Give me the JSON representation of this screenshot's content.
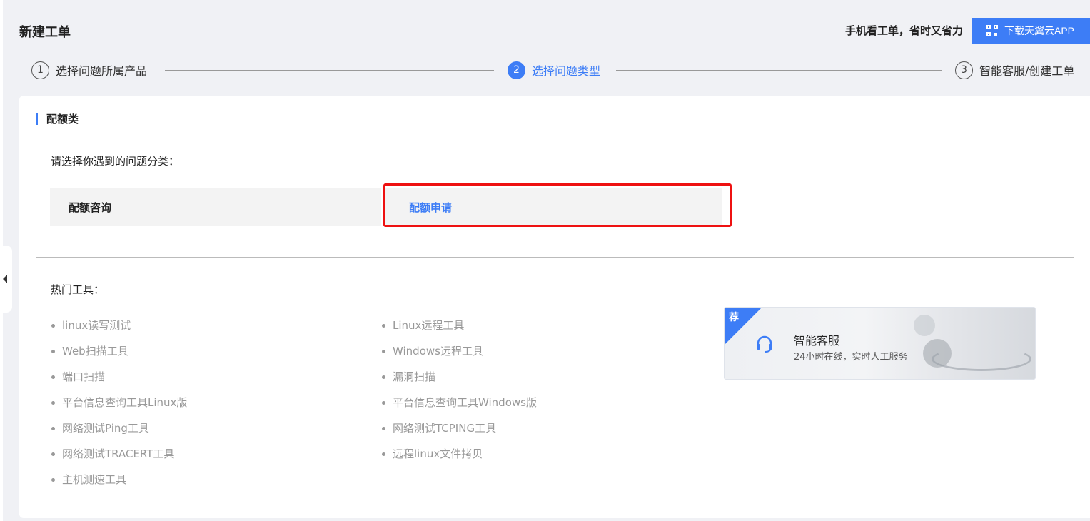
{
  "header": {
    "title": "新建工单",
    "promo_text": "手机看工单，省时又省力",
    "download_label": "下载天翼云APP",
    "download_icon": "qr-code-icon"
  },
  "steps": [
    {
      "num": "1",
      "label": "选择问题所属产品",
      "active": false
    },
    {
      "num": "2",
      "label": "选择问题类型",
      "active": true
    },
    {
      "num": "3",
      "label": "智能客服/创建工单",
      "active": false
    }
  ],
  "section": {
    "title": "配额类",
    "prompt": "请选择你遇到的问题分类：",
    "options": [
      "配额咨询",
      "配额申请"
    ],
    "selected": "配额申请"
  },
  "tools": {
    "title": "热门工具：",
    "col_a": [
      "linux读写测试",
      "Web扫描工具",
      "端口扫描",
      "平台信息查询工具Linux版",
      "网络测试Ping工具",
      "网络测试TRACERT工具",
      "主机测速工具"
    ],
    "col_b": [
      "Linux远程工具",
      "Windows远程工具",
      "漏洞扫描",
      "平台信息查询工具Windows版",
      "网络测试TCPING工具",
      "远程linux文件拷贝"
    ]
  },
  "recommend": {
    "badge": "荐",
    "title": "智能客服",
    "subtitle": "24小时在线，实时人工服务",
    "icon": "headset-icon"
  },
  "colors": {
    "accent": "#3d7df6",
    "highlight": "#ee1111"
  }
}
